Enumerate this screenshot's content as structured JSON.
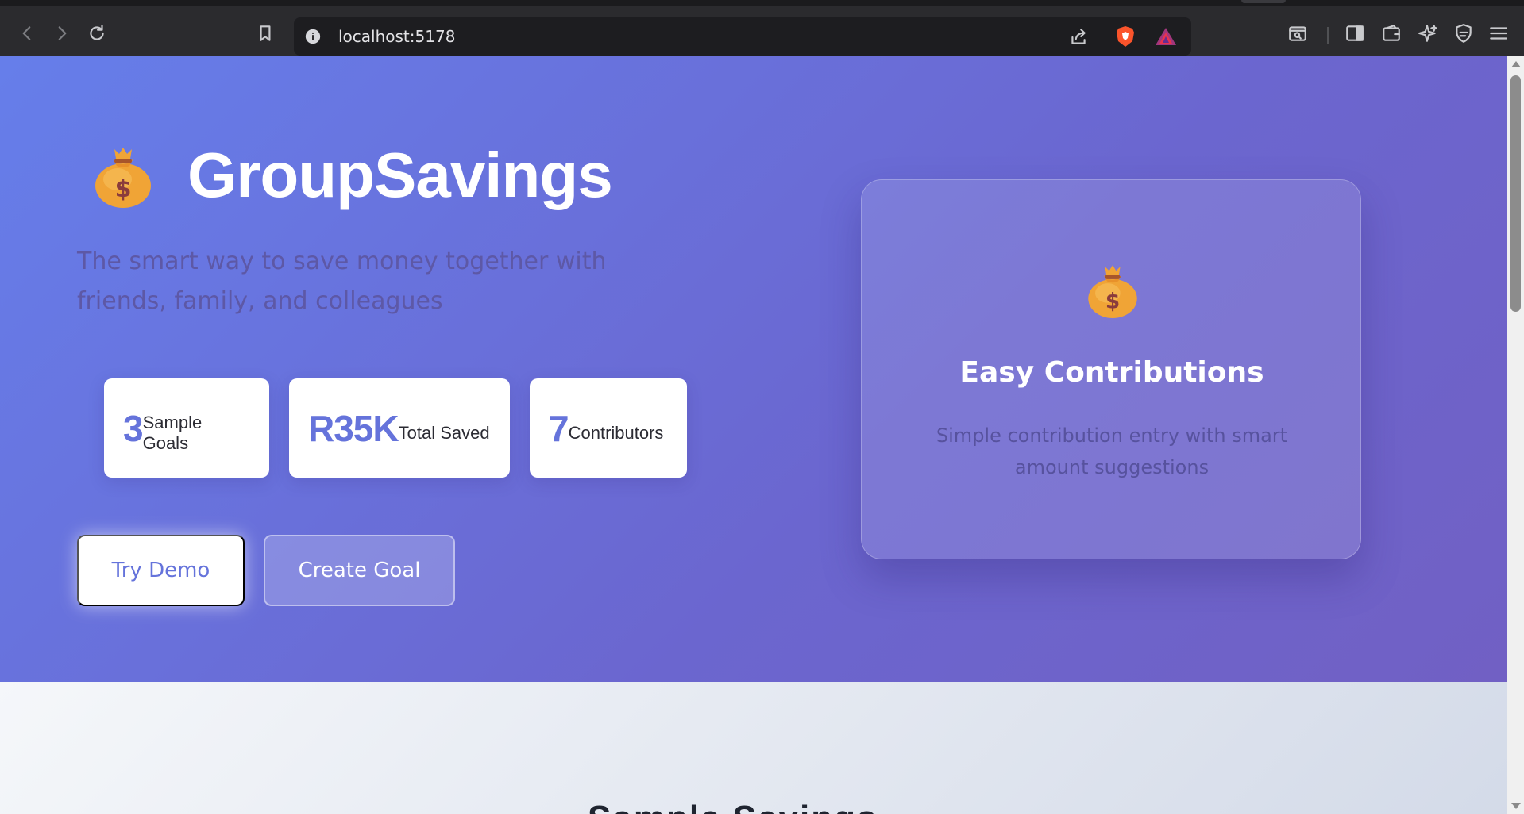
{
  "browser": {
    "url": "localhost:5178",
    "icons": [
      "back-icon",
      "forward-icon",
      "reload-icon",
      "bookmark-icon",
      "site-info-icon",
      "share-icon",
      "brave-shields-icon",
      "brave-rewards-icon",
      "search-tabs-icon",
      "sidebar-icon",
      "wallet-icon",
      "leo-ai-icon",
      "vpn-icon",
      "menu-icon"
    ]
  },
  "hero": {
    "brand_title": "GroupSavings",
    "tagline": "The smart way to save money together with friends, family, and colleagues",
    "stats": [
      {
        "number": "3",
        "label": "Sample Goals"
      },
      {
        "number": "R35K",
        "label": "Total Saved"
      },
      {
        "number": "7",
        "label": "Contributors"
      }
    ],
    "buttons": {
      "demo_label": "Try Demo",
      "create_label": "Create Goal"
    },
    "feature_card": {
      "title": "Easy Contributions",
      "description": "Simple contribution entry with smart amount suggestions"
    }
  },
  "section2": {
    "title_partial": "Sample Savings"
  },
  "colors": {
    "hero_gradient_start": "#667eea",
    "hero_gradient_end": "#7160c4",
    "accent": "#6573db"
  }
}
